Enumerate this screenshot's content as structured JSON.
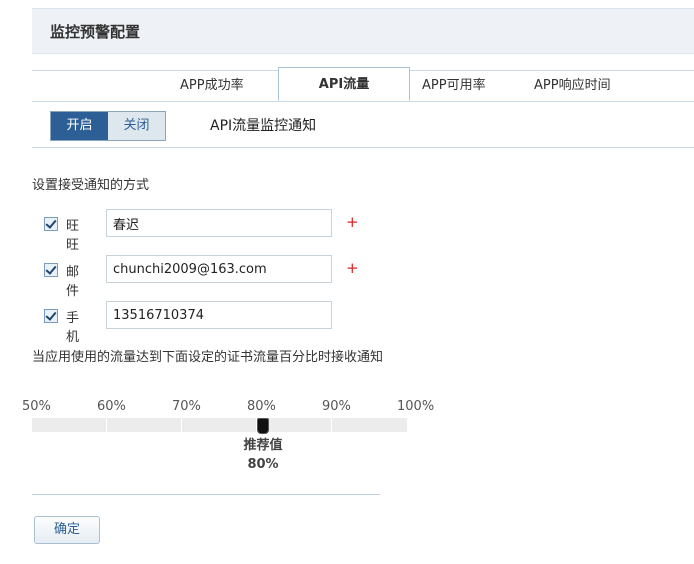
{
  "header": {
    "title": "监控预警配置"
  },
  "tabs": [
    {
      "label": "APP成功率",
      "active": false
    },
    {
      "label": "API流量",
      "active": true
    },
    {
      "label": "APP可用率",
      "active": false
    },
    {
      "label": "APP响应时间",
      "active": false
    }
  ],
  "toggle": {
    "on_label": "开启",
    "off_label": "关闭",
    "selected": "开启"
  },
  "panel_note": "API流量监控通知",
  "notify": {
    "heading": "设置接受通知的方式",
    "wangwang": {
      "label": "旺旺",
      "value": "春迟",
      "checked": true
    },
    "email": {
      "label": "邮件",
      "value": "chunchi2009@163.com",
      "checked": true
    },
    "mobile": {
      "label": "手机",
      "value": "13516710374",
      "checked": true
    },
    "plus_symbol": "+"
  },
  "threshold": {
    "heading": "当应用使用的流量达到下面设定的证书流量百分比时接收通知",
    "ticks": [
      "50%",
      "60%",
      "70%",
      "80%",
      "90%",
      "100%"
    ],
    "value_percent": 80,
    "recommended_label": "推荐值",
    "recommended_value": "80%"
  },
  "confirm_label": "确定"
}
